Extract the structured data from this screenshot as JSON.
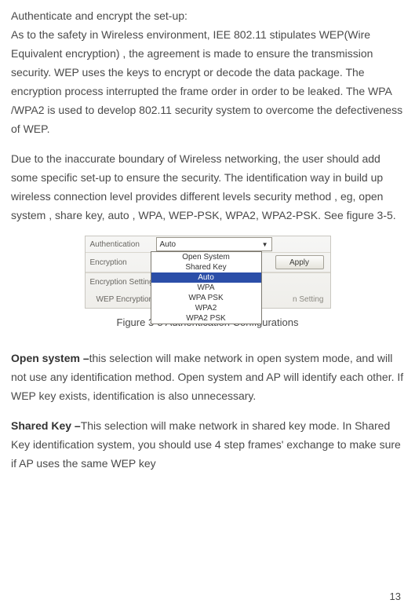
{
  "body": {
    "heading": "Authenticate and encrypt the set-up:",
    "para1": "As to the safety in Wireless environment, IEE 802.11 stipulates WEP(Wire Equivalent encryption) , the agreement is made to ensure the transmission security. WEP uses the keys to encrypt or decode the data package. The encryption process interrupted the frame order in order to be leaked. The WPA /WPA2 is used to develop 802.11 security system to overcome the defectiveness of WEP.",
    "para2": "Due to the inaccurate boundary of Wireless networking, the user should add some specific set-up to ensure the security. The identification way in build up wireless connection level provides different levels security method , eg, open system  , share key, auto , WPA, WEP-PSK, WPA2, WPA2-PSK. See figure 3-5.",
    "open_label": "Open system –",
    "open_rest": "this selection will make network in open system mode, and will not use any identification method. Open system and AP will identify each other. If WEP key exists, identification is also unnecessary.",
    "shared_label": "Shared Key –",
    "shared_rest": "This selection will make network in shared key mode. In Shared Key identification system, you should use 4 step frames' exchange to make sure if AP uses the same WEP key",
    "caption": "Figure 3-5 Authentication Configurations",
    "page_number": "13"
  },
  "figure": {
    "rows": {
      "auth_label": "Authentication",
      "auth_value": "Auto",
      "enc_label": "Encryption",
      "apply_btn": "Apply",
      "section_label": "Encryption Setting",
      "wep_label": "WEP Encryption",
      "right_truncated": "n Setting"
    },
    "dropdown": {
      "options": [
        "Open System",
        "Shared Key",
        "Auto",
        "WPA",
        "WPA PSK",
        "WPA2",
        "WPA2 PSK"
      ],
      "selected_index": 2
    }
  }
}
